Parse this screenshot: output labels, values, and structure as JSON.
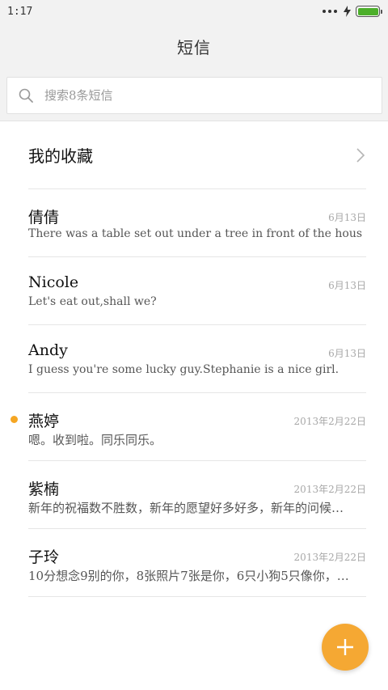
{
  "status_bar": {
    "time": "1:17",
    "icons": [
      "more-dots-icon",
      "charging-bolt-icon",
      "battery-icon"
    ],
    "battery_color": "#4caf2a"
  },
  "header": {
    "title": "短信"
  },
  "search": {
    "placeholder": "搜索8条短信",
    "icon": "search-icon"
  },
  "favorites": {
    "label": "我的收藏",
    "icon": "chevron-right-icon"
  },
  "conversations": [
    {
      "name": "倩倩",
      "date": "6月13日",
      "preview": "There was a table set out under a tree in front of the hous",
      "unread": false
    },
    {
      "name": "Nicole",
      "date": "6月13日",
      "preview": "Let's eat out,shall we?",
      "unread": false
    },
    {
      "name": "Andy",
      "date": "6月13日",
      "preview": "I guess you're some lucky guy.Stephanie is a nice girl.",
      "unread": false
    },
    {
      "name": "燕婷",
      "date": "2013年2月22日",
      "preview": "嗯。收到啦。同乐同乐。",
      "unread": true
    },
    {
      "name": "紫楠",
      "date": "2013年2月22日",
      "preview": "新年的祝福数不胜数，新年的愿望好多好多，新年的问候…",
      "unread": false
    },
    {
      "name": "子玲",
      "date": "2013年2月22日",
      "preview": "10分想念9别的你，8张照片7张是你，6只小狗5只像你，…",
      "unread": false
    }
  ],
  "fab": {
    "icon": "plus-icon",
    "color": "#f5a833"
  },
  "colors": {
    "accent": "#f5a623",
    "background": "#ffffff",
    "header_bg": "#f2f2f2"
  }
}
